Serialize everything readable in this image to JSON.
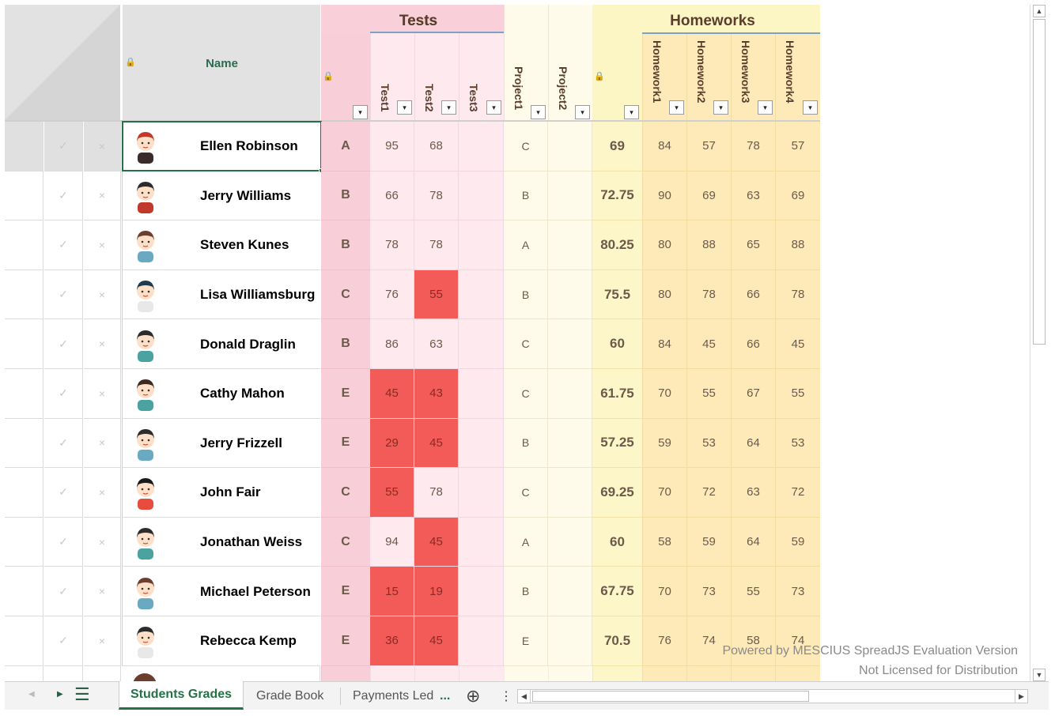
{
  "headers": {
    "name": "Name",
    "tests": "Tests",
    "homeworks": "Homeworks",
    "test_cols": [
      "Test1",
      "Test2",
      "Test3"
    ],
    "project_cols": [
      "Project1",
      "Project2"
    ],
    "homework_cols": [
      "Homework1",
      "Homework2",
      "Homework3",
      "Homework4"
    ]
  },
  "icons": {
    "check": "✓",
    "cross": "×",
    "dropdown": "▾",
    "lock": "lock-icon"
  },
  "rows": [
    {
      "name": "Ellen Robinson",
      "grade": "A",
      "test1": "95",
      "test2": "68",
      "test3": "",
      "project1": "C",
      "project2": "",
      "avg": "69",
      "hw1": "84",
      "hw2": "57",
      "hw3": "78",
      "hw4": "57"
    },
    {
      "name": "Jerry Williams",
      "grade": "B",
      "test1": "66",
      "test2": "78",
      "test3": "",
      "project1": "B",
      "project2": "",
      "avg": "72.75",
      "hw1": "90",
      "hw2": "69",
      "hw3": "63",
      "hw4": "69"
    },
    {
      "name": "Steven Kunes",
      "grade": "B",
      "test1": "78",
      "test2": "78",
      "test3": "",
      "project1": "A",
      "project2": "",
      "avg": "80.25",
      "hw1": "80",
      "hw2": "88",
      "hw3": "65",
      "hw4": "88"
    },
    {
      "name": "Lisa Williamsburg",
      "grade": "C",
      "test1": "76",
      "test2": "55",
      "test3": "",
      "project1": "B",
      "project2": "",
      "avg": "75.5",
      "hw1": "80",
      "hw2": "78",
      "hw3": "66",
      "hw4": "78"
    },
    {
      "name": "Donald Draglin",
      "grade": "B",
      "test1": "86",
      "test2": "63",
      "test3": "",
      "project1": "C",
      "project2": "",
      "avg": "60",
      "hw1": "84",
      "hw2": "45",
      "hw3": "66",
      "hw4": "45"
    },
    {
      "name": "Cathy Mahon",
      "grade": "E",
      "test1": "45",
      "test2": "43",
      "test3": "",
      "project1": "C",
      "project2": "",
      "avg": "61.75",
      "hw1": "70",
      "hw2": "55",
      "hw3": "67",
      "hw4": "55"
    },
    {
      "name": "Jerry Frizzell",
      "grade": "E",
      "test1": "29",
      "test2": "45",
      "test3": "",
      "project1": "B",
      "project2": "",
      "avg": "57.25",
      "hw1": "59",
      "hw2": "53",
      "hw3": "64",
      "hw4": "53"
    },
    {
      "name": "John Fair",
      "grade": "C",
      "test1": "55",
      "test2": "78",
      "test3": "",
      "project1": "C",
      "project2": "",
      "avg": "69.25",
      "hw1": "70",
      "hw2": "72",
      "hw3": "63",
      "hw4": "72"
    },
    {
      "name": "Jonathan Weiss",
      "grade": "C",
      "test1": "94",
      "test2": "45",
      "test3": "",
      "project1": "A",
      "project2": "",
      "avg": "60",
      "hw1": "58",
      "hw2": "59",
      "hw3": "64",
      "hw4": "59"
    },
    {
      "name": "Michael Peterson",
      "grade": "E",
      "test1": "15",
      "test2": "19",
      "test3": "",
      "project1": "B",
      "project2": "",
      "avg": "67.75",
      "hw1": "70",
      "hw2": "73",
      "hw3": "55",
      "hw4": "73"
    },
    {
      "name": "Rebecca Kemp",
      "grade": "E",
      "test1": "36",
      "test2": "45",
      "test3": "",
      "project1": "E",
      "project2": "",
      "avg": "70.5",
      "hw1": "76",
      "hw2": "74",
      "hw3": "58",
      "hw4": "74"
    }
  ],
  "failing_threshold": 56,
  "watermark": {
    "line1": "Powered by MESCIUS SpreadJS Evaluation Version",
    "line2": "Not Licensed for Distribution"
  },
  "tabs": {
    "active": "Students Grades",
    "items": [
      "Grade Book",
      "Payments Led"
    ],
    "more": "...",
    "add": "⊕",
    "menu": "⋮"
  },
  "colors": {
    "tests_header": "#f9d0da",
    "tests_body": "#fde9ee",
    "grade_col": "#f8cfd9",
    "fail": "#f25b57",
    "projects": "#fefbea",
    "homeworks_header": "#fcf5c4",
    "homeworks_body": "#feeab9",
    "avg_col": "#fdf6c9",
    "selected_border": "#217346"
  }
}
